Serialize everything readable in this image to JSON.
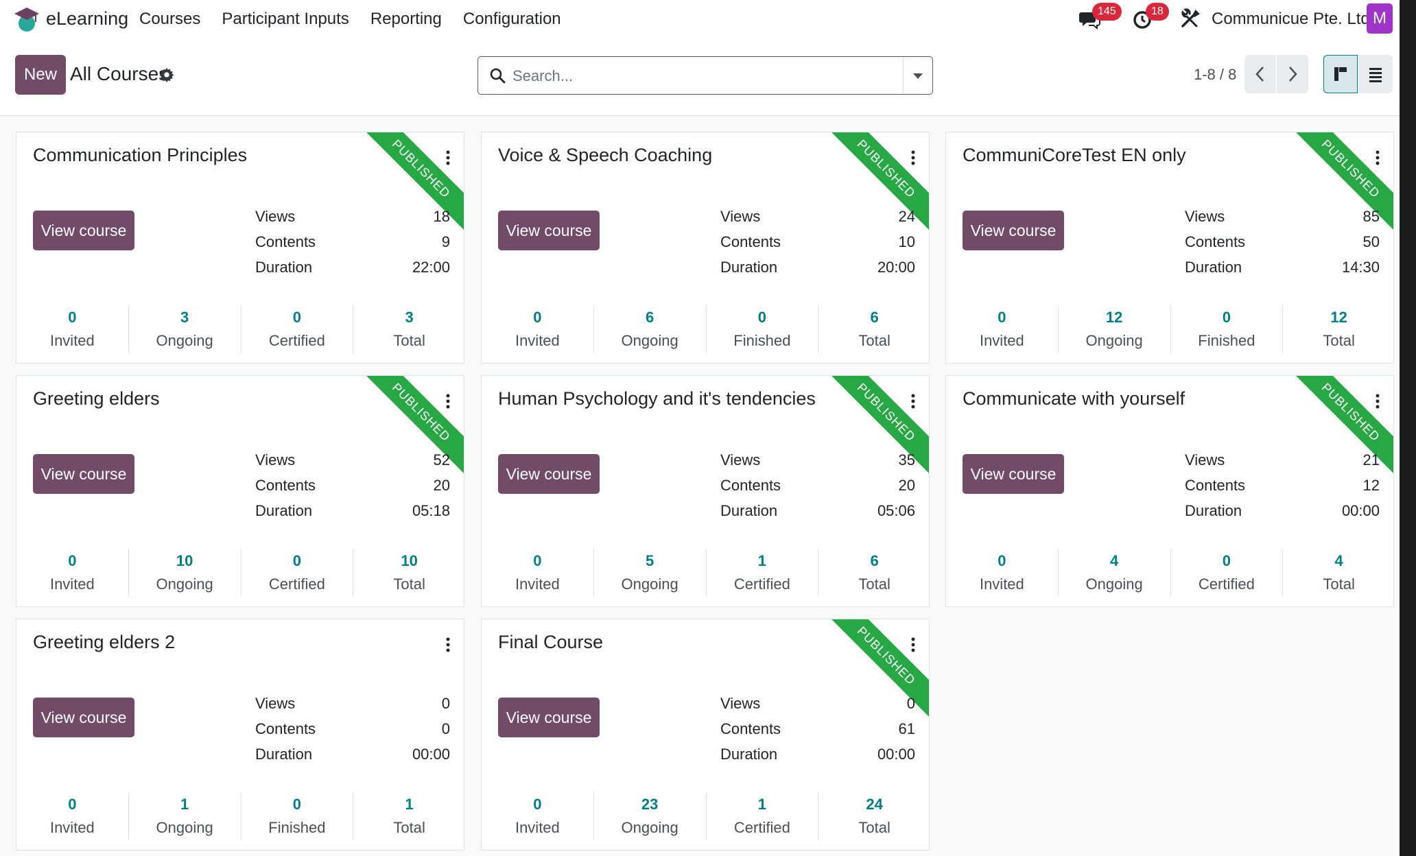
{
  "navbar": {
    "app_name": "eLearning",
    "menu": [
      "Courses",
      "Participant Inputs",
      "Reporting",
      "Configuration"
    ],
    "messages_badge": "145",
    "activities_badge": "18",
    "company": "Communicue Pte. Ltd.",
    "avatar_letter": "M"
  },
  "control": {
    "new_label": "New",
    "breadcrumb": "All Courses",
    "search_placeholder": "Search...",
    "pager": "1-8 / 8"
  },
  "colors": {
    "primary": "#714b67",
    "teal": "#017e84",
    "ribbon": "#28a745",
    "badge": "#d9283c"
  },
  "courses": [
    {
      "title": "Communication Principles",
      "published": "PUBLISHED",
      "button": "View course",
      "stats": [
        [
          "Views",
          "18"
        ],
        [
          "Contents",
          "9"
        ],
        [
          "Duration",
          "22:00"
        ]
      ],
      "counters": [
        [
          "0",
          "Invited"
        ],
        [
          "3",
          "Ongoing"
        ],
        [
          "0",
          "Certified"
        ],
        [
          "3",
          "Total"
        ]
      ]
    },
    {
      "title": "Voice & Speech Coaching",
      "published": "PUBLISHED",
      "button": "View course",
      "stats": [
        [
          "Views",
          "24"
        ],
        [
          "Contents",
          "10"
        ],
        [
          "Duration",
          "20:00"
        ]
      ],
      "counters": [
        [
          "0",
          "Invited"
        ],
        [
          "6",
          "Ongoing"
        ],
        [
          "0",
          "Finished"
        ],
        [
          "6",
          "Total"
        ]
      ]
    },
    {
      "title": "CommuniCoreTest EN only",
      "published": "PUBLISHED",
      "button": "View course",
      "stats": [
        [
          "Views",
          "85"
        ],
        [
          "Contents",
          "50"
        ],
        [
          "Duration",
          "14:30"
        ]
      ],
      "counters": [
        [
          "0",
          "Invited"
        ],
        [
          "12",
          "Ongoing"
        ],
        [
          "0",
          "Finished"
        ],
        [
          "12",
          "Total"
        ]
      ]
    },
    {
      "title": "Greeting elders",
      "published": "PUBLISHED",
      "button": "View course",
      "stats": [
        [
          "Views",
          "52"
        ],
        [
          "Contents",
          "20"
        ],
        [
          "Duration",
          "05:18"
        ]
      ],
      "counters": [
        [
          "0",
          "Invited"
        ],
        [
          "10",
          "Ongoing"
        ],
        [
          "0",
          "Certified"
        ],
        [
          "10",
          "Total"
        ]
      ]
    },
    {
      "title": "Human Psychology and it's tendencies",
      "published": "PUBLISHED",
      "button": "View course",
      "stats": [
        [
          "Views",
          "35"
        ],
        [
          "Contents",
          "20"
        ],
        [
          "Duration",
          "05:06"
        ]
      ],
      "counters": [
        [
          "0",
          "Invited"
        ],
        [
          "5",
          "Ongoing"
        ],
        [
          "1",
          "Certified"
        ],
        [
          "6",
          "Total"
        ]
      ]
    },
    {
      "title": "Communicate with yourself",
      "published": "PUBLISHED",
      "button": "View course",
      "stats": [
        [
          "Views",
          "21"
        ],
        [
          "Contents",
          "12"
        ],
        [
          "Duration",
          "00:00"
        ]
      ],
      "counters": [
        [
          "0",
          "Invited"
        ],
        [
          "4",
          "Ongoing"
        ],
        [
          "0",
          "Certified"
        ],
        [
          "4",
          "Total"
        ]
      ]
    },
    {
      "title": "Greeting elders 2",
      "published": "",
      "button": "View course",
      "stats": [
        [
          "Views",
          "0"
        ],
        [
          "Contents",
          "0"
        ],
        [
          "Duration",
          "00:00"
        ]
      ],
      "counters": [
        [
          "0",
          "Invited"
        ],
        [
          "1",
          "Ongoing"
        ],
        [
          "0",
          "Finished"
        ],
        [
          "1",
          "Total"
        ]
      ]
    },
    {
      "title": "Final Course",
      "published": "PUBLISHED",
      "button": "View course",
      "stats": [
        [
          "Views",
          "0"
        ],
        [
          "Contents",
          "61"
        ],
        [
          "Duration",
          "00:00"
        ]
      ],
      "counters": [
        [
          "0",
          "Invited"
        ],
        [
          "23",
          "Ongoing"
        ],
        [
          "1",
          "Certified"
        ],
        [
          "24",
          "Total"
        ]
      ]
    }
  ]
}
